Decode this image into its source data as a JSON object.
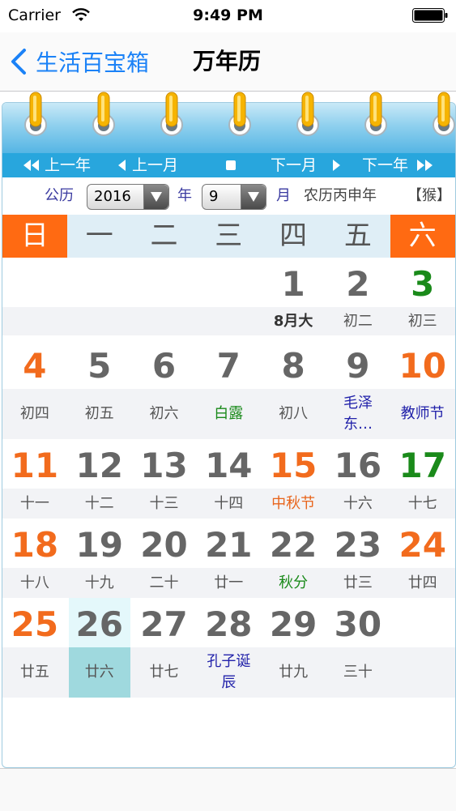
{
  "status_bar": {
    "carrier": "Carrier",
    "time": "9:49 PM"
  },
  "nav": {
    "back_label": "生活百宝箱",
    "title": "万年历"
  },
  "controls": {
    "prev_year": "上一年",
    "prev_month": "上一月",
    "next_month": "下一月",
    "next_year": "下一年"
  },
  "selector": {
    "gregorian_label": "公历",
    "year_value": "2016",
    "year_unit": "年",
    "month_value": "9",
    "month_unit": "月",
    "lunar_year": "农历丙申年",
    "zodiac": "【猴】"
  },
  "weekdays": [
    "日",
    "一",
    "二",
    "三",
    "四",
    "五",
    "六"
  ],
  "days": [
    [
      null,
      null,
      null,
      null,
      {
        "d": "1",
        "l": "8月大",
        "nc": "",
        "lc": "bold"
      },
      {
        "d": "2",
        "l": "初二",
        "nc": "",
        "lc": ""
      },
      {
        "d": "3",
        "l": "初三",
        "nc": "jieqi",
        "lc": ""
      }
    ],
    [
      {
        "d": "4",
        "l": "初四",
        "nc": "weekend",
        "lc": ""
      },
      {
        "d": "5",
        "l": "初五",
        "nc": "",
        "lc": ""
      },
      {
        "d": "6",
        "l": "初六",
        "nc": "",
        "lc": ""
      },
      {
        "d": "7",
        "l": "白露",
        "nc": "",
        "lc": "term"
      },
      {
        "d": "8",
        "l": "初八",
        "nc": "",
        "lc": ""
      },
      {
        "d": "9",
        "l": "毛泽东…",
        "nc": "",
        "lc": "festival"
      },
      {
        "d": "10",
        "l": "教师节",
        "nc": "weekend",
        "lc": "festival"
      }
    ],
    [
      {
        "d": "11",
        "l": "十一",
        "nc": "weekend",
        "lc": ""
      },
      {
        "d": "12",
        "l": "十二",
        "nc": "",
        "lc": ""
      },
      {
        "d": "13",
        "l": "十三",
        "nc": "",
        "lc": ""
      },
      {
        "d": "14",
        "l": "十四",
        "nc": "",
        "lc": ""
      },
      {
        "d": "15",
        "l": "中秋节",
        "nc": "weekend",
        "lc": "holiday"
      },
      {
        "d": "16",
        "l": "十六",
        "nc": "",
        "lc": ""
      },
      {
        "d": "17",
        "l": "十七",
        "nc": "jieqi",
        "lc": ""
      }
    ],
    [
      {
        "d": "18",
        "l": "十八",
        "nc": "weekend",
        "lc": ""
      },
      {
        "d": "19",
        "l": "十九",
        "nc": "",
        "lc": ""
      },
      {
        "d": "20",
        "l": "二十",
        "nc": "",
        "lc": ""
      },
      {
        "d": "21",
        "l": "廿一",
        "nc": "",
        "lc": ""
      },
      {
        "d": "22",
        "l": "秋分",
        "nc": "",
        "lc": "term"
      },
      {
        "d": "23",
        "l": "廿三",
        "nc": "",
        "lc": ""
      },
      {
        "d": "24",
        "l": "廿四",
        "nc": "weekend",
        "lc": ""
      }
    ],
    [
      {
        "d": "25",
        "l": "廿五",
        "nc": "weekend",
        "lc": ""
      },
      {
        "d": "26",
        "l": "廿六",
        "nc": "",
        "lc": "",
        "today": true
      },
      {
        "d": "27",
        "l": "廿七",
        "nc": "",
        "lc": ""
      },
      {
        "d": "28",
        "l": "孔子诞辰",
        "nc": "",
        "lc": "festival"
      },
      {
        "d": "29",
        "l": "廿九",
        "nc": "",
        "lc": ""
      },
      {
        "d": "30",
        "l": "三十",
        "nc": "",
        "lc": ""
      },
      null
    ]
  ]
}
